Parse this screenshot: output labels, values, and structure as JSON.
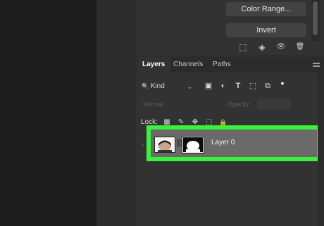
{
  "buttons": {
    "color_range": "Color Range...",
    "invert": "Invert"
  },
  "select_icons": [
    {
      "name": "marquee-selection-icon",
      "glyph": "⬚"
    },
    {
      "name": "load-channel-selection-icon",
      "glyph": "◈"
    },
    {
      "name": "visibility-eye-icon",
      "glyph": "👁"
    },
    {
      "name": "trash-icon",
      "glyph": "🗑"
    }
  ],
  "tabs": [
    {
      "label": "Layers",
      "active": true
    },
    {
      "label": "Channels",
      "active": false
    },
    {
      "label": "Paths",
      "active": false
    }
  ],
  "filter": {
    "kind_label": "Kind",
    "search_glyph": "🔍",
    "chevron_glyph": "⌄",
    "icons": [
      {
        "name": "pixel-layer-filter-icon",
        "glyph": "▣"
      },
      {
        "name": "adjustment-layer-filter-icon",
        "glyph": "◐"
      },
      {
        "name": "type-layer-filter-icon",
        "glyph": "T"
      },
      {
        "name": "shape-layer-filter-icon",
        "glyph": "⬚"
      },
      {
        "name": "smart-object-filter-icon",
        "glyph": "⧉"
      },
      {
        "name": "filter-toggle-dot-icon",
        "glyph": "●"
      }
    ]
  },
  "blend": {
    "mode": "Normal",
    "opacity_label": "Opacity:"
  },
  "lock": {
    "label": "Lock:",
    "icons": [
      {
        "name": "lock-transparent-pixels-icon",
        "glyph": "▦"
      },
      {
        "name": "lock-image-pixels-icon",
        "glyph": "✎"
      },
      {
        "name": "lock-position-icon",
        "glyph": "✥"
      },
      {
        "name": "lock-artboard-icon",
        "glyph": "⬚"
      },
      {
        "name": "lock-all-icon",
        "glyph": "🔒"
      }
    ]
  },
  "layer": {
    "name": "Layer 0",
    "link_glyph": "⛓"
  },
  "colors": {
    "highlight": "#3af23a",
    "panel": "#323232"
  }
}
